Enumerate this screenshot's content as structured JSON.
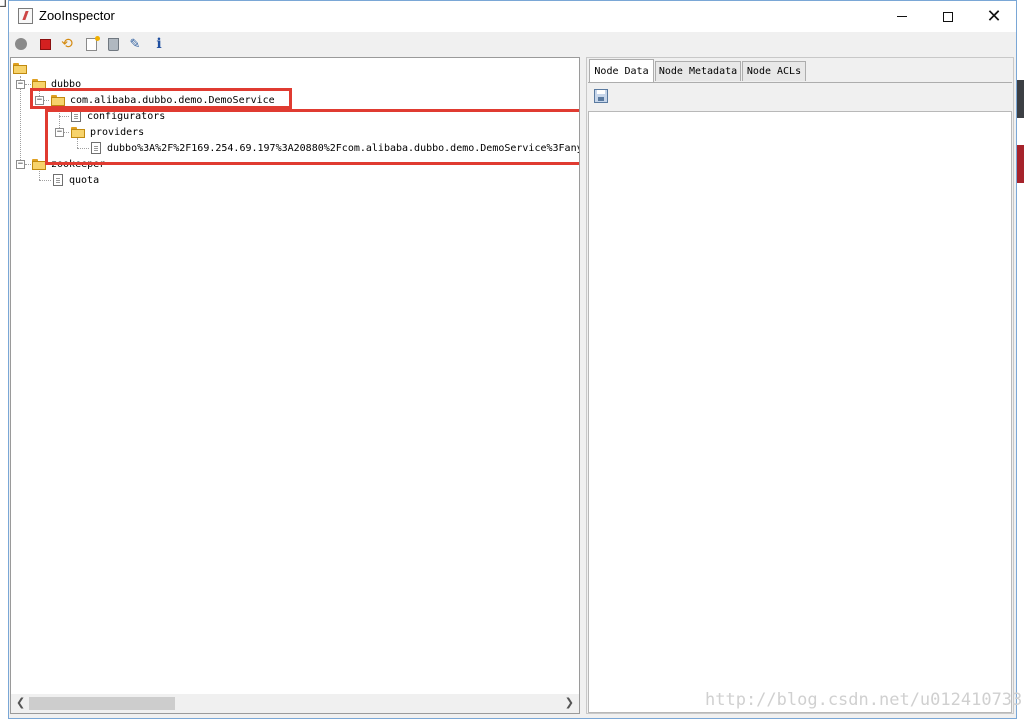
{
  "window": {
    "title": "ZooInspector",
    "min_label": "",
    "max_label": "",
    "close_label": "✕"
  },
  "toolbar": {
    "icons": [
      "connect-icon",
      "disconnect-icon",
      "refresh-icon",
      "add-node-icon",
      "delete-node-icon",
      "edit-icon",
      "info-icon"
    ],
    "info_glyph": "i",
    "refresh_glyph": "⟲",
    "edit_glyph": "✎"
  },
  "tree": {
    "root_label": "",
    "dubbo": "dubbo",
    "service": "com.alibaba.dubbo.demo.DemoService",
    "configurators": "configurators",
    "providers": "providers",
    "provider_url": "dubbo%3A%2F%2F169.254.69.197%3A20880%2Fcom.alibaba.dubbo.demo.DemoService%3Fany",
    "zookeeper": "zookeeper",
    "quota": "quota"
  },
  "tabs": [
    "Node Data",
    "Node Metadata",
    "Node ACLs"
  ],
  "watermark": "http://blog.csdn.net/u012410733",
  "colors": {
    "highlight_box": "#e03b31",
    "folder": "#f7d36b"
  }
}
